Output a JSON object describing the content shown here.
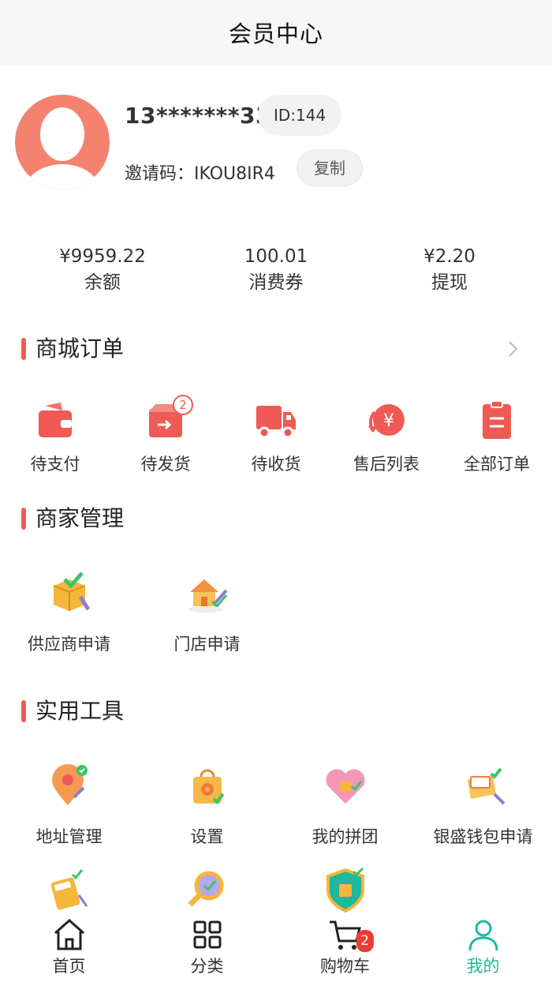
{
  "header": {
    "title": "会员中心"
  },
  "profile": {
    "phone": "13*******33",
    "id_text": "ID:144",
    "invite_label": "邀请码：",
    "invite_code": "IKOU8IR4",
    "copy_label": "复制"
  },
  "stats": [
    {
      "value": "¥9959.22",
      "label": "余额"
    },
    {
      "value": "100.01",
      "label": "消费券"
    },
    {
      "value": "¥2.20",
      "label": "提现"
    }
  ],
  "orders": {
    "title": "商城订单",
    "items": [
      {
        "label": "待支付",
        "icon": "wallet-icon"
      },
      {
        "label": "待发货",
        "icon": "box-ship-icon",
        "badge": "2"
      },
      {
        "label": "待收货",
        "icon": "truck-icon"
      },
      {
        "label": "售后列表",
        "icon": "refund-icon"
      },
      {
        "label": "全部订单",
        "icon": "clipboard-icon"
      }
    ]
  },
  "merchant": {
    "title": "商家管理",
    "items": [
      {
        "label": "供应商申请",
        "icon": "supplier-box-icon"
      },
      {
        "label": "门店申请",
        "icon": "store-house-icon"
      }
    ]
  },
  "tools": {
    "title": "实用工具",
    "items": [
      {
        "label": "地址管理",
        "icon": "location-pin-icon"
      },
      {
        "label": "设置",
        "icon": "settings-bag-icon"
      },
      {
        "label": "我的拼团",
        "icon": "group-heart-icon"
      },
      {
        "label": "银盛钱包申请",
        "icon": "wallet-card-icon"
      },
      {
        "label": "",
        "icon": "calculator-icon"
      },
      {
        "label": "",
        "icon": "magnifier-icon"
      },
      {
        "label": "",
        "icon": "shield-icon"
      }
    ]
  },
  "tabbar": {
    "items": [
      {
        "label": "首页",
        "icon": "home-icon"
      },
      {
        "label": "分类",
        "icon": "grid-icon"
      },
      {
        "label": "购物车",
        "icon": "cart-icon",
        "badge": "2"
      },
      {
        "label": "我的",
        "icon": "user-icon"
      }
    ]
  },
  "colors": {
    "accent": "#ef5a55",
    "active_tab": "#1fb89a",
    "avatar_bg": "#f4826f"
  }
}
